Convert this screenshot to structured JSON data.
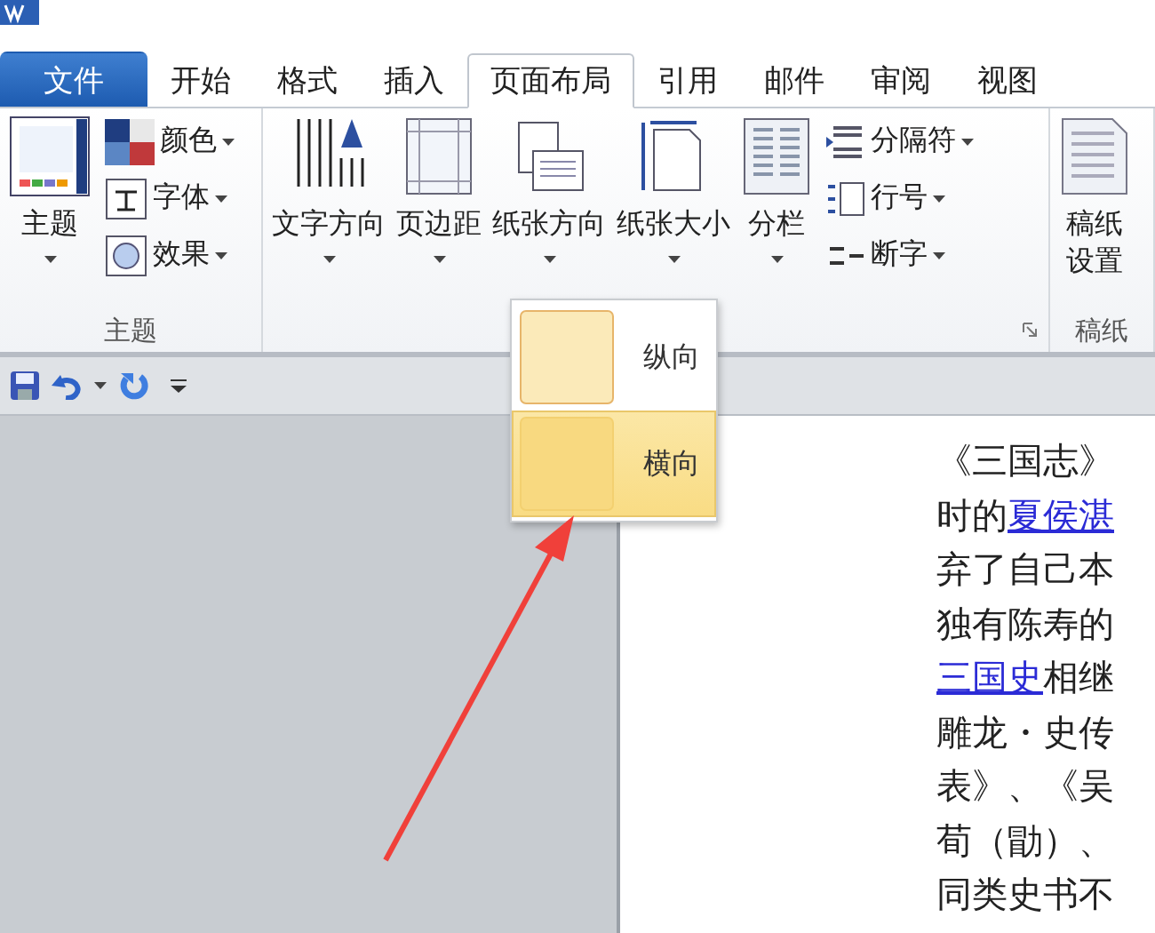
{
  "tabs": [
    {
      "label": "文件",
      "kind": "file",
      "selected": false
    },
    {
      "label": "开始",
      "kind": "tab",
      "selected": false
    },
    {
      "label": "格式",
      "kind": "tab",
      "selected": false
    },
    {
      "label": "插入",
      "kind": "tab",
      "selected": false
    },
    {
      "label": "页面布局",
      "kind": "tab",
      "selected": true
    },
    {
      "label": "引用",
      "kind": "tab",
      "selected": false
    },
    {
      "label": "邮件",
      "kind": "tab",
      "selected": false
    },
    {
      "label": "审阅",
      "kind": "tab",
      "selected": false
    },
    {
      "label": "视图",
      "kind": "tab",
      "selected": false
    }
  ],
  "ribbon_groups": [
    {
      "label": "主题",
      "launcher": false,
      "large": [
        {
          "label": "主题"
        }
      ],
      "small": [
        {
          "label": "颜色"
        },
        {
          "label": "字体"
        },
        {
          "label": "效果"
        }
      ]
    },
    {
      "launcher": true,
      "large": [
        {
          "label": "文字方向"
        },
        {
          "label": "页边距"
        },
        {
          "label": "纸张方向"
        },
        {
          "label": "纸张大小"
        },
        {
          "label": "分栏"
        }
      ],
      "small": [
        {
          "label": "分隔符"
        },
        {
          "label": "行号"
        },
        {
          "label": "断字"
        }
      ]
    },
    {
      "label": "稿纸",
      "launcher": false,
      "large": [
        {
          "label": "稿纸设置"
        }
      ]
    }
  ],
  "orientation_menu": {
    "items": [
      {
        "label": "纵向",
        "selected": false
      },
      {
        "label": "横向",
        "selected": true
      }
    ]
  },
  "document": {
    "lines": [
      [
        {
          "text": "《三国志》",
          "link": false
        }
      ],
      [
        {
          "text": "时的",
          "link": false
        },
        {
          "text": "夏侯湛",
          "link": true
        }
      ],
      [
        {
          "text": "弃了自己本",
          "link": false
        }
      ],
      [
        {
          "text": "独有陈寿的",
          "link": false
        }
      ],
      [
        {
          "text": "三国史",
          "link": true
        },
        {
          "text": "相继",
          "link": false
        }
      ],
      [
        {
          "text": "雕龙・史传",
          "link": false
        }
      ],
      [
        {
          "text": "表》、《吴",
          "link": false
        }
      ],
      [
        {
          "text": "荀（勖）、",
          "link": false
        }
      ],
      [
        {
          "text": "同类史书不",
          "link": false
        }
      ]
    ]
  }
}
